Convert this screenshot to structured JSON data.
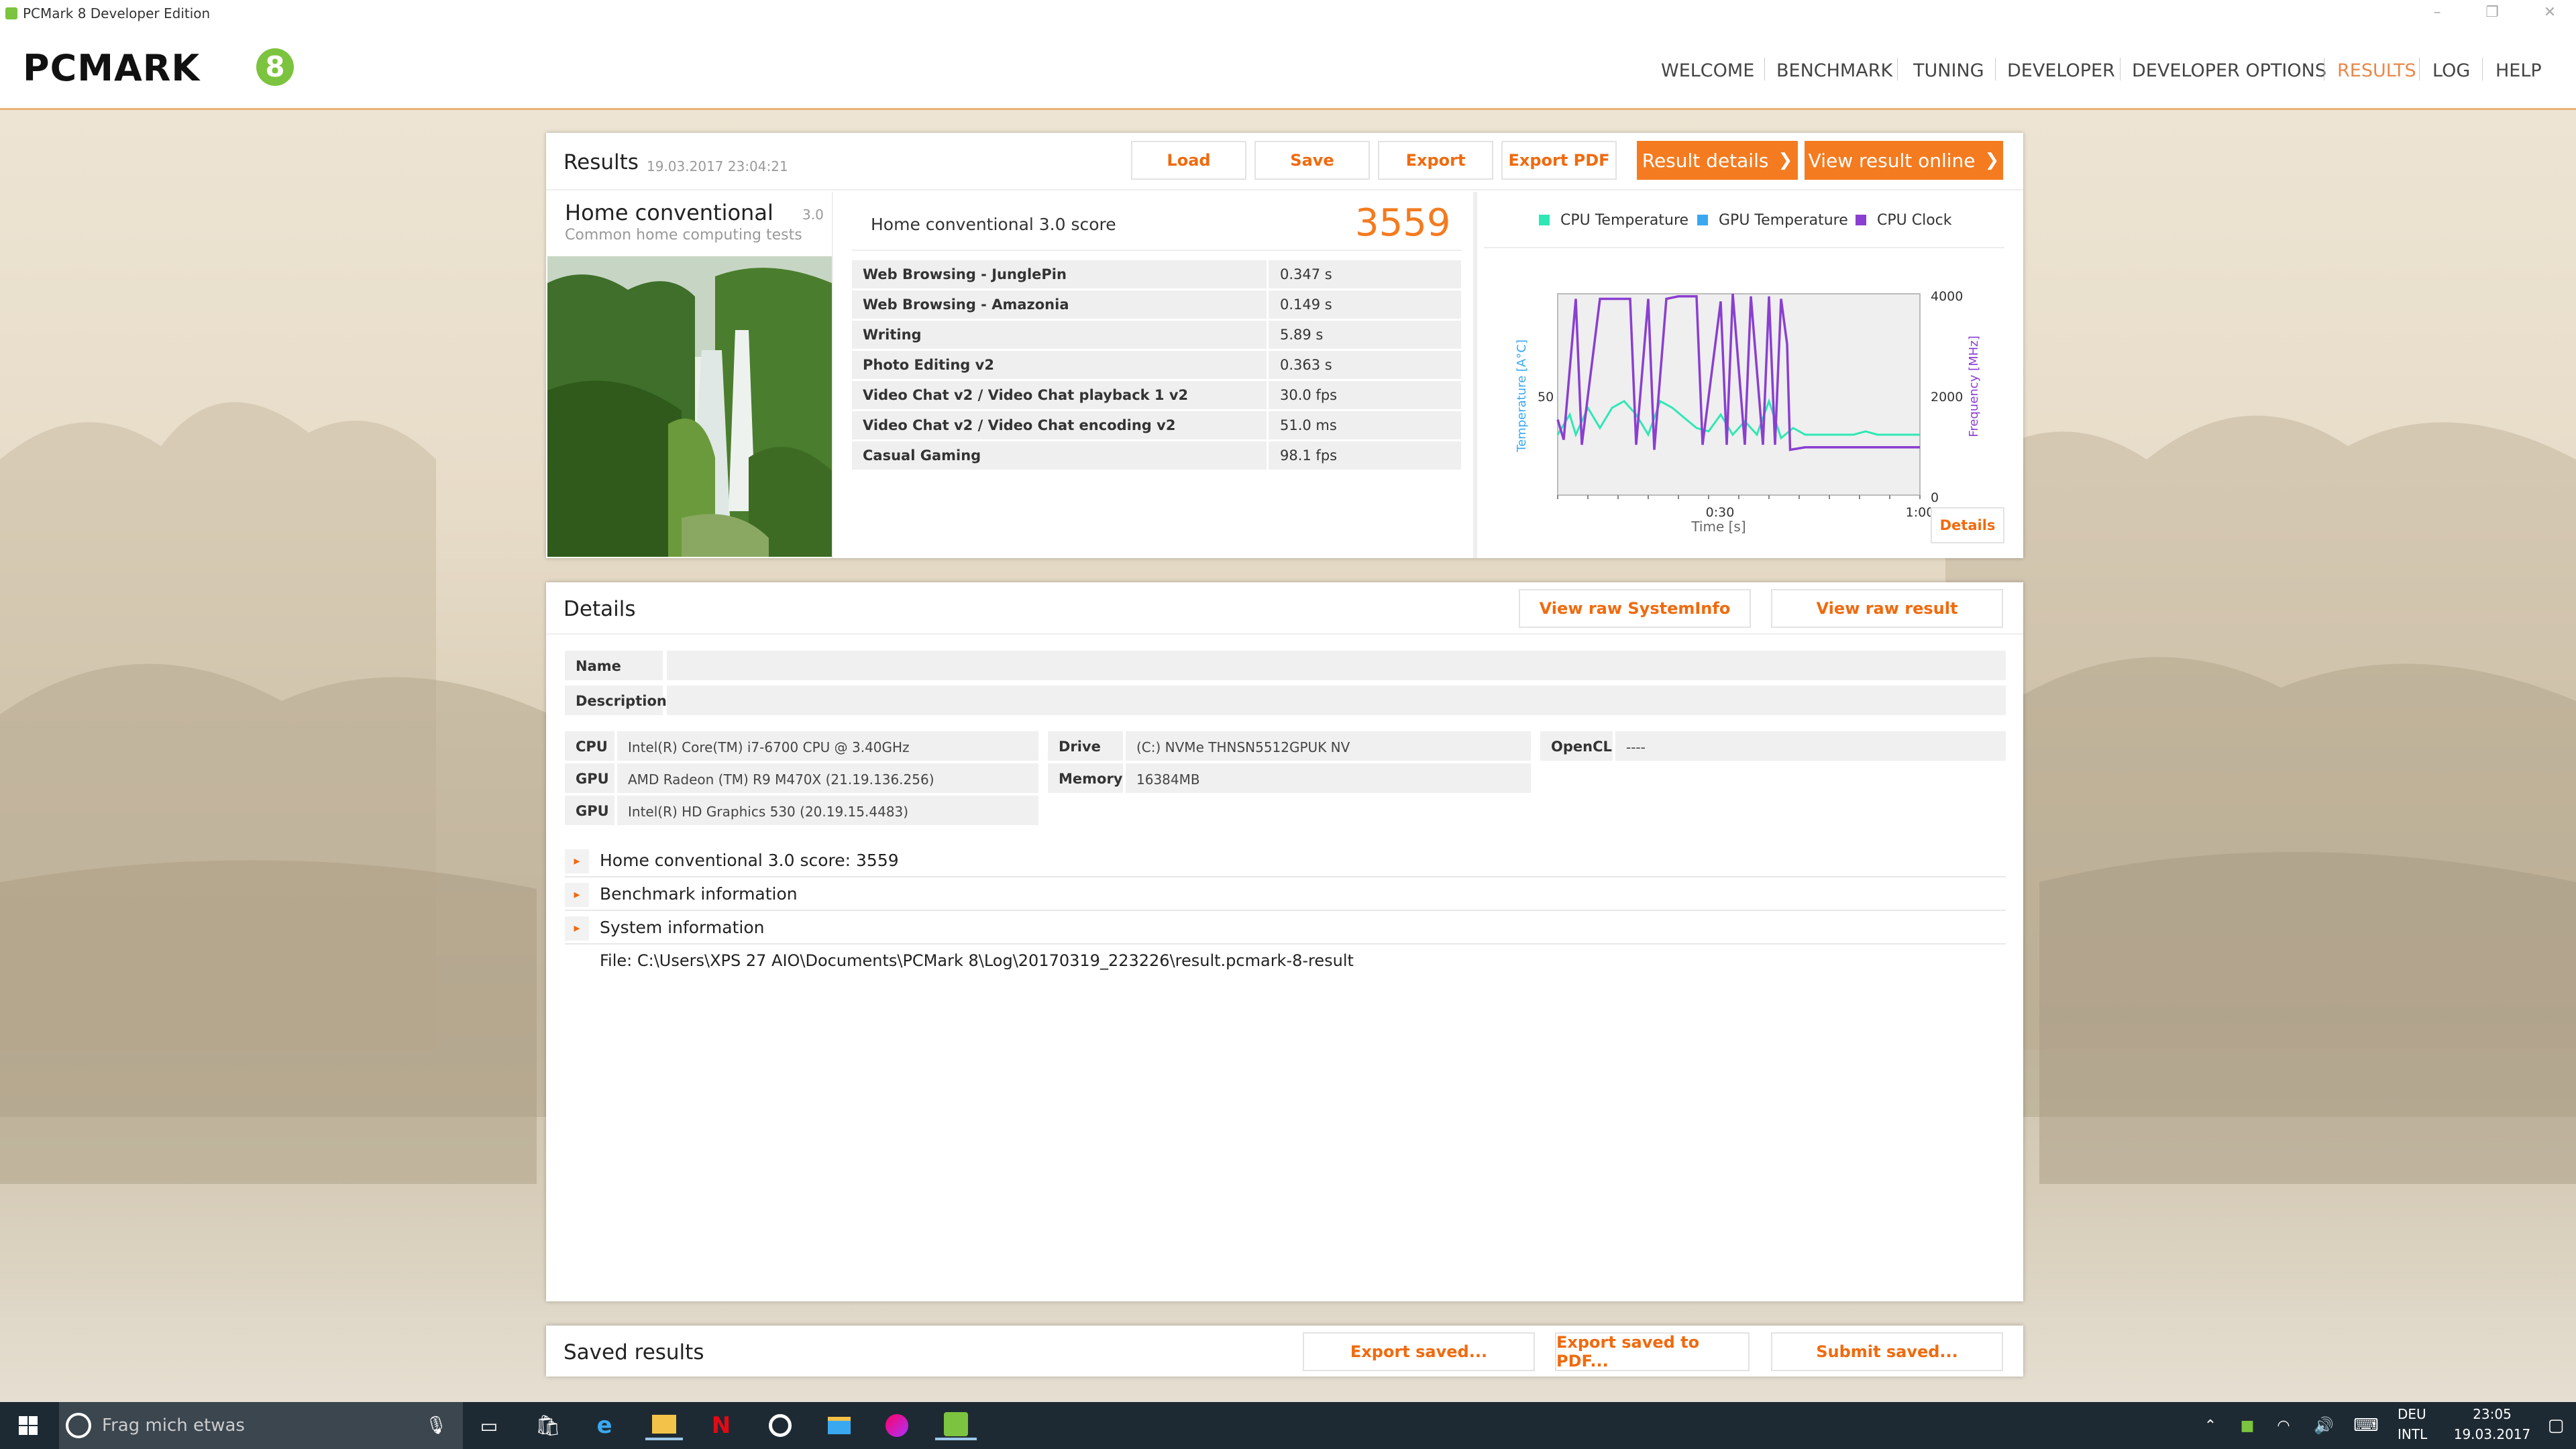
{
  "window": {
    "title": "PCMark 8 Developer Edition"
  },
  "brand": {
    "logo_text": "PCMARK",
    "logo_num": "8"
  },
  "nav": [
    "WELCOME",
    "BENCHMARK",
    "TUNING",
    "DEVELOPER",
    "DEVELOPER OPTIONS",
    "RESULTS",
    "LOG",
    "HELP"
  ],
  "nav_active": "RESULTS",
  "results": {
    "title": "Results",
    "timestamp": "19.03.2017 23:04:21",
    "buttons": {
      "load": "Load",
      "save": "Save",
      "export": "Export",
      "export_pdf": "Export PDF",
      "result_details": "Result details",
      "view_online": "View result online"
    },
    "benchmark_name": "Home conventional",
    "benchmark_version": "3.0",
    "benchmark_desc": "Common home computing tests",
    "score_label": "Home conventional 3.0 score",
    "score": "3559",
    "tests": [
      {
        "name": "Web Browsing - JunglePin",
        "value": "0.347 s"
      },
      {
        "name": "Web Browsing - Amazonia",
        "value": "0.149 s"
      },
      {
        "name": "Writing",
        "value": "5.89 s"
      },
      {
        "name": "Photo Editing v2",
        "value": "0.363 s"
      },
      {
        "name": "Video Chat v2 / Video Chat playback 1 v2",
        "value": "30.0 fps"
      },
      {
        "name": "Video Chat v2 / Video Chat encoding v2",
        "value": "51.0 ms"
      },
      {
        "name": "Casual Gaming",
        "value": "98.1 fps"
      }
    ],
    "details_button": "Details"
  },
  "chart_data": {
    "type": "line",
    "legend": [
      "CPU Temperature",
      "GPU Temperature",
      "CPU Clock"
    ],
    "colors": {
      "cpu_temp": "#2ee8b4",
      "gpu_temp": "#3aa8f0",
      "cpu_clock": "#8a3fd1"
    },
    "xlabel": "Time [s]",
    "ylabel_left": "Temperature [A°C]",
    "ylabel_right": "Frequency [MHz]",
    "x_ticks": [
      "0:30",
      "1:00"
    ],
    "y_left_ticks": [
      "50"
    ],
    "y_right_ticks": [
      "4000",
      "2000",
      "0"
    ],
    "xlim": [
      0,
      60
    ],
    "ylim_right": [
      0,
      4000
    ],
    "ylim_left": [
      20,
      80
    ],
    "series": [
      {
        "name": "CPU Temperature",
        "x": [
          0,
          2,
          3,
          5,
          7,
          9,
          11,
          13,
          15,
          17,
          19,
          21,
          23,
          25,
          27,
          29,
          31,
          33,
          35,
          37,
          39,
          41,
          43,
          45,
          47,
          49,
          51,
          53,
          55,
          57,
          60
        ],
        "y": [
          38,
          44,
          38,
          46,
          40,
          46,
          48,
          44,
          38,
          48,
          46,
          43,
          40,
          39,
          44,
          38,
          42,
          38,
          48,
          37,
          40,
          38,
          38,
          38,
          38,
          38,
          39,
          38,
          38,
          38,
          38
        ]
      },
      {
        "name": "CPU Clock",
        "x": [
          0,
          1,
          3,
          4,
          7,
          8,
          12,
          13,
          15,
          16,
          18,
          20,
          23,
          24,
          27,
          28,
          29,
          31,
          32,
          34,
          35,
          36,
          37,
          38,
          38.5,
          41,
          50,
          60
        ],
        "y": [
          1500,
          1100,
          3900,
          1000,
          3900,
          3900,
          3900,
          1000,
          3900,
          900,
          3900,
          3950,
          3950,
          1000,
          3850,
          1000,
          4000,
          1000,
          3950,
          1000,
          3950,
          1000,
          3900,
          3000,
          900,
          950,
          950,
          950
        ]
      }
    ]
  },
  "details": {
    "title": "Details",
    "btn_sysinfo": "View raw SystemInfo",
    "btn_raw": "View raw result",
    "name_label": "Name",
    "description_label": "Description",
    "cpu_label": "CPU",
    "cpu": "Intel(R) Core(TM) i7-6700 CPU @ 3.40GHz",
    "gpu_label": "GPU",
    "gpu1": "AMD Radeon (TM) R9 M470X (21.19.136.256)",
    "gpu2": "Intel(R) HD Graphics 530 (20.19.15.4483)",
    "drive_label": "Drive",
    "drive": "(C:) NVMe THNSN5512GPUK NV",
    "memory_label": "Memory",
    "memory": "16384MB",
    "opencl_label": "OpenCL",
    "opencl": "----",
    "sections": [
      "Home conventional 3.0 score: 3559",
      "Benchmark information",
      "System information"
    ],
    "file": "File: C:\\Users\\XPS 27 AIO\\Documents\\PCMark 8\\Log\\20170319_223226\\result.pcmark-8-result"
  },
  "saved": {
    "title": "Saved results",
    "btn_export": "Export saved...",
    "btn_pdf": "Export saved to PDF...",
    "btn_submit": "Submit saved..."
  },
  "taskbar": {
    "search_placeholder": "Frag mich etwas",
    "lang1": "DEU",
    "lang2": "INTL",
    "time": "23:05",
    "date": "19.03.2017"
  }
}
